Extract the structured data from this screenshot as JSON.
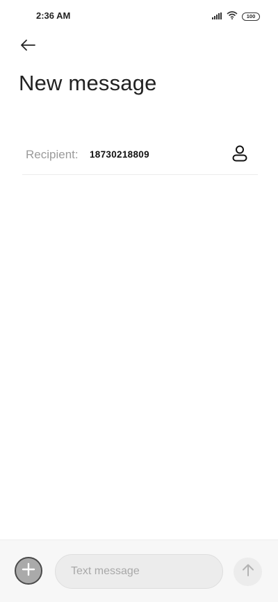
{
  "status_bar": {
    "time": "2:36 AM",
    "battery": "100",
    "icons": [
      "signal-icon",
      "wifi-icon",
      "battery-icon"
    ]
  },
  "header": {
    "back_icon": "arrow-left-icon",
    "title": "New message"
  },
  "recipient": {
    "label": "Recipient:",
    "value": "18730218809",
    "contact_icon": "person-icon"
  },
  "compose": {
    "add_icon": "plus-icon",
    "placeholder": "Text message",
    "value": "",
    "send_icon": "arrow-up-icon"
  },
  "colors": {
    "background": "#ffffff",
    "compose_bar": "#f7f7f7",
    "input_bg": "#ececec",
    "label_gray": "#9a9a9a",
    "add_button": "#aaaaaa"
  }
}
